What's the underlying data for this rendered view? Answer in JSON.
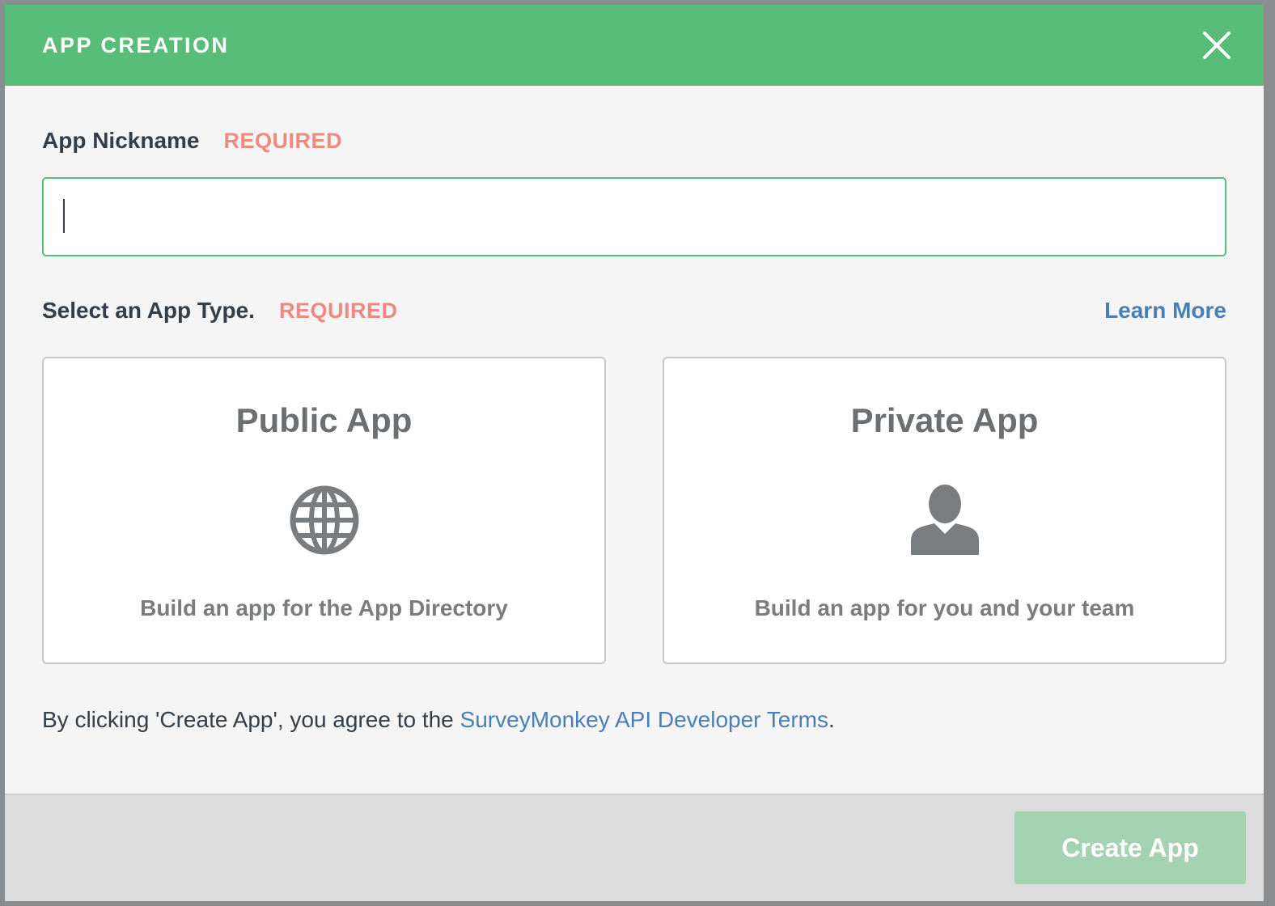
{
  "header": {
    "title": "APP CREATION",
    "close_icon": "close-icon"
  },
  "nickname": {
    "label": "App Nickname",
    "required": "REQUIRED",
    "value": "",
    "placeholder": ""
  },
  "app_type": {
    "label": "Select an App Type.",
    "required": "REQUIRED",
    "learn_more": "Learn More",
    "options": [
      {
        "title": "Public App",
        "description": "Build an app for the App Directory",
        "icon": "globe-icon"
      },
      {
        "title": "Private App",
        "description": "Build an app for you and your team",
        "icon": "user-icon"
      }
    ]
  },
  "terms": {
    "prefix": "By clicking 'Create App', you agree to the ",
    "link": "SurveyMonkey API Developer Terms",
    "suffix": "."
  },
  "footer": {
    "create_label": "Create App"
  },
  "colors": {
    "header_green": "#58bd78",
    "required_red": "#f08a7e",
    "link_blue": "#4a7fb5",
    "disabled_button": "#a4d3b1"
  }
}
